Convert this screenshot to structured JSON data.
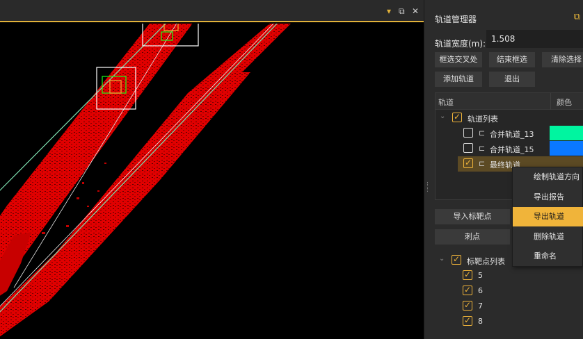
{
  "viewport": {
    "controls": {
      "dropdown": "▾",
      "float": "⧉",
      "close": "✕"
    }
  },
  "panel": {
    "title": "轨道管理器",
    "pin_icon": "pin-icon",
    "track_width": {
      "label": "轨道宽度(m):",
      "value": "1.508"
    },
    "buttons": {
      "box_select_cross": "框选交叉处",
      "end_box_select": "结束框选",
      "clear_selection": "清除选择",
      "add_track": "添加轨道",
      "exit": "退出",
      "import_targets": "导入标靶点",
      "pick_point": "刺点"
    },
    "tree": {
      "columns": [
        "轨道",
        "颜色"
      ],
      "root": {
        "label": "轨道列表",
        "checked": true
      },
      "items": [
        {
          "label": "合并轨道_13",
          "checked": false,
          "color": "#00f5a0"
        },
        {
          "label": "合并轨道_15",
          "checked": false,
          "color": "#0a78ff"
        },
        {
          "label": "最终轨道",
          "checked": true,
          "color": ""
        }
      ]
    },
    "targets": {
      "root": {
        "label": "标靶点列表",
        "checked": true
      },
      "items": [
        {
          "label": "5",
          "checked": true
        },
        {
          "label": "6",
          "checked": true
        },
        {
          "label": "7",
          "checked": true
        },
        {
          "label": "8",
          "checked": true
        }
      ]
    }
  },
  "context_menu": {
    "items": [
      {
        "label": "绘制轨道方向",
        "highlighted": false
      },
      {
        "label": "导出报告",
        "highlighted": false
      },
      {
        "label": "导出轨道",
        "highlighted": true
      },
      {
        "label": "删除轨道",
        "highlighted": false
      },
      {
        "label": "重命名",
        "highlighted": false
      }
    ]
  },
  "colors": {
    "accent": "#f0b43a",
    "point_cloud": "#ff0000",
    "track_line": "#7ee0b0",
    "selection_box": "#ffffff"
  }
}
